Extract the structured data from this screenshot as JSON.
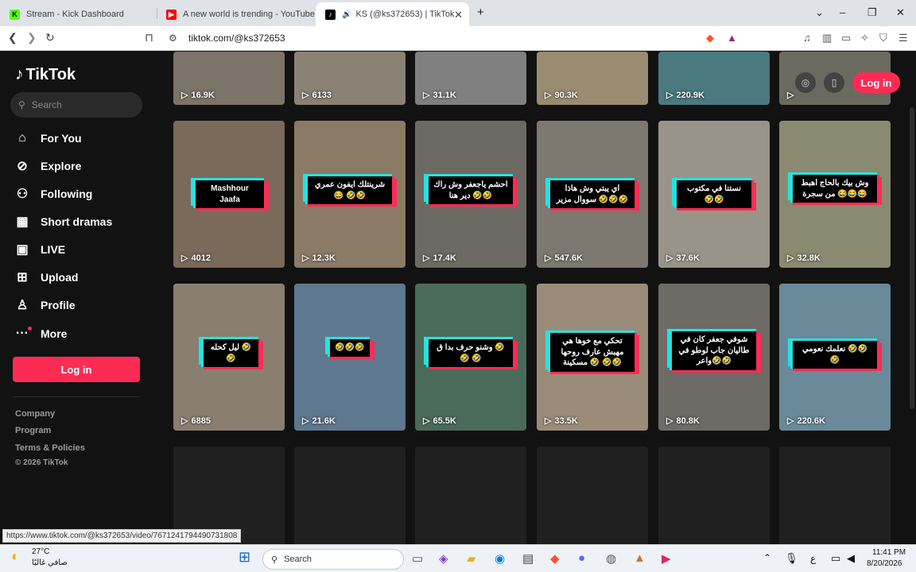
{
  "browser": {
    "tabs": [
      {
        "title": "Stream - Kick Dashboard",
        "icon": "kick-icon",
        "color": "#53fc18"
      },
      {
        "title": "A new world is trending - YouTube",
        "icon": "youtube-icon",
        "color": "#ff0000"
      },
      {
        "title": "KS (@ks372653) | TikTok",
        "icon": "tiktok-icon",
        "color": "#000000"
      }
    ],
    "url": "tiktok.com/@ks372653",
    "status_url": "https://www.tiktok.com/@ks372653/video/7671241794490731808"
  },
  "sidebar": {
    "logo": "TikTok",
    "search_placeholder": "Search",
    "items": [
      {
        "label": "For You",
        "icon": "home-icon"
      },
      {
        "label": "Explore",
        "icon": "compass-icon"
      },
      {
        "label": "Following",
        "icon": "following-icon"
      },
      {
        "label": "Short dramas",
        "icon": "film-icon"
      },
      {
        "label": "LIVE",
        "icon": "live-icon"
      },
      {
        "label": "Upload",
        "icon": "upload-icon"
      },
      {
        "label": "Profile",
        "icon": "profile-icon"
      },
      {
        "label": "More",
        "icon": "more-icon"
      }
    ],
    "login": "Log in",
    "footer": [
      "Company",
      "Program",
      "Terms & Policies"
    ],
    "copyright": "© 2026 TikTok"
  },
  "header": {
    "login": "Log in"
  },
  "videos_row0": [
    "16.9K",
    "6133",
    "31.1K",
    "90.3K",
    "220.9K",
    ""
  ],
  "videos": [
    {
      "views": "4012",
      "caption": "Mashhour Jaafa",
      "bg": "#7a6a5a"
    },
    {
      "views": "12.3K",
      "caption": "شرينتلك ايفون عمري 😂 🤣🤣",
      "bg": "#8b7a66"
    },
    {
      "views": "17.4K",
      "caption": "احشم ياجعفر وش راك دير هنا 🤣🤣",
      "bg": "#6d6a63"
    },
    {
      "views": "547.6K",
      "caption": "اي يبتي وش هاذا سووال مزير 🤣🤣🤣",
      "bg": "#7d7870"
    },
    {
      "views": "37.6K",
      "caption": "نستنا في مكتوب 🤣🤣",
      "bg": "#9a9488"
    },
    {
      "views": "32.8K",
      "caption": "وش بيك بالحاج اهبط من سجرة 😂😂😂",
      "bg": "#8a8a70"
    },
    {
      "views": "6885",
      "caption": "ليل كحله 🤣🤣",
      "bg": "#8a7e70"
    },
    {
      "views": "21.6K",
      "caption": "🤣🤣🤣",
      "bg": "#5e7890"
    },
    {
      "views": "65.5K",
      "caption": "وشنو حرف بدا ق 🤣🤣 🤣",
      "bg": "#4a6a5a"
    },
    {
      "views": "33.5K",
      "caption": "تحكي مع خوها هي مهبش عارف روحها مسكينة 🤣 🤣🤣",
      "bg": "#9a8c78"
    },
    {
      "views": "80.8K",
      "caption": "شوفي جعفر كان في طاليان جاب لوطو في واعر🤣🤣",
      "bg": "#6e6a66"
    },
    {
      "views": "220.6K",
      "caption": "نعلمك نعومي 🤣🤣🤣",
      "bg": "#6a8a9a"
    }
  ],
  "taskbar": {
    "weather_temp": "27°C",
    "weather_desc": "صافي غالبًا",
    "search": "Search",
    "time": "11:41 PM",
    "date": "8/20/2026",
    "lang": "ع"
  }
}
